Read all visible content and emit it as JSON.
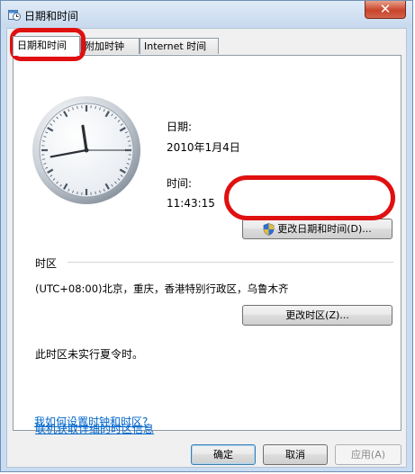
{
  "window": {
    "title": "日期和时间",
    "close_glyph": "✕"
  },
  "tabs": [
    {
      "label": "日期和时间",
      "active": true
    },
    {
      "label": "附加时钟",
      "active": false
    },
    {
      "label": "Internet 时间",
      "active": false
    }
  ],
  "datetime": {
    "date_label": "日期:",
    "date_value": "2010年1月4日",
    "time_label": "时间:",
    "time_value": "11:43:15",
    "change_button": "更改日期和时间(D)..."
  },
  "timezone": {
    "section_label": "时区",
    "value": "(UTC+08:00)北京，重庆，香港特别行政区，乌鲁木齐",
    "change_button": "更改时区(Z)...",
    "dst_note": "此时区未实行夏令时。"
  },
  "links": {
    "online_info": "联机获取详细的时区信息",
    "how_to": "我如何设置时钟和时区?"
  },
  "footer": {
    "ok": "确定",
    "cancel": "取消",
    "apply": "应用(A)"
  },
  "icons": {
    "title": "clock-calendar-icon",
    "shield": "uac-shield-icon"
  },
  "colors": {
    "annotation": "#e01010",
    "link": "#0066cc"
  }
}
